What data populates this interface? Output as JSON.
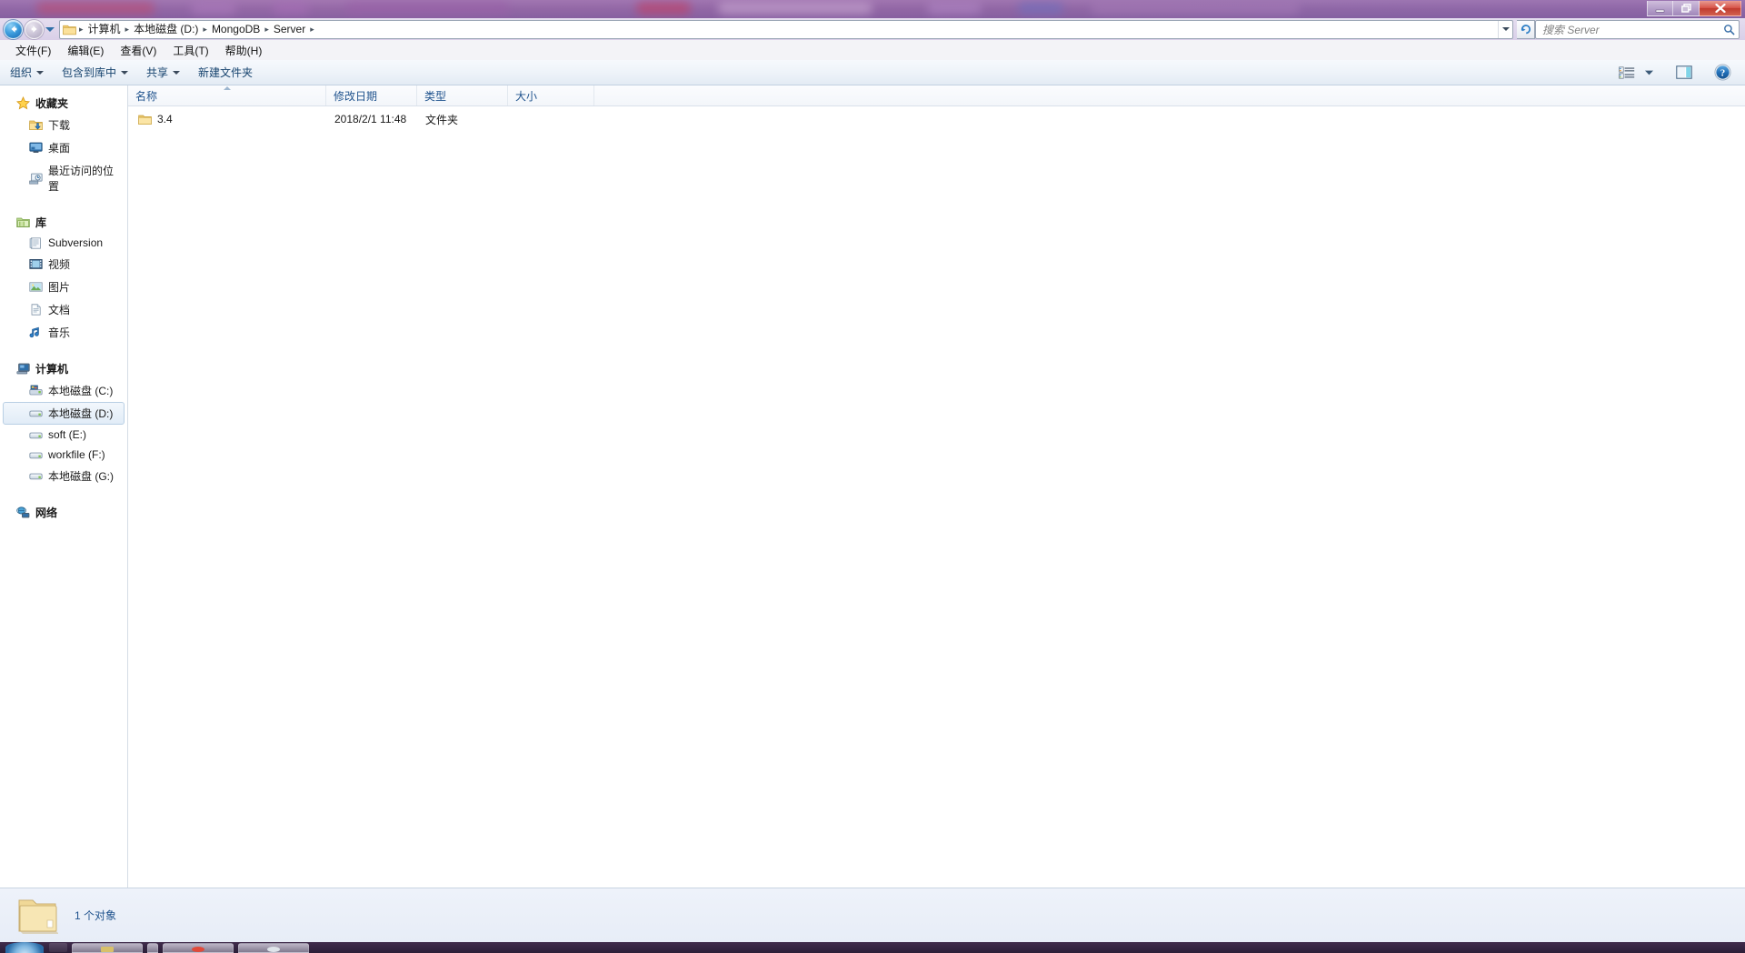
{
  "window": {
    "controls": [
      {
        "name": "minimize",
        "glyph": "minimize"
      },
      {
        "name": "restore",
        "glyph": "restore"
      },
      {
        "name": "close",
        "glyph": "close"
      }
    ]
  },
  "navbar": {
    "back_tooltip": "后退",
    "forward_tooltip": "前进",
    "recent_tooltip": "最近访问的位置",
    "breadcrumbs": [
      {
        "label": "计算机"
      },
      {
        "label": "本地磁盘 (D:)"
      },
      {
        "label": "MongoDB"
      },
      {
        "label": "Server"
      }
    ],
    "refresh_icon": "refresh-icon",
    "folder_icon": "folder-icon"
  },
  "search": {
    "placeholder": "搜索 Server",
    "value": "",
    "icon": "search-icon"
  },
  "menubar": {
    "items": [
      {
        "label": "文件(F)"
      },
      {
        "label": "编辑(E)"
      },
      {
        "label": "查看(V)"
      },
      {
        "label": "工具(T)"
      },
      {
        "label": "帮助(H)"
      }
    ]
  },
  "toolbar": {
    "items": [
      {
        "label": "组织",
        "has_caret": true
      },
      {
        "label": "包含到库中",
        "has_caret": true
      },
      {
        "label": "共享",
        "has_caret": true
      },
      {
        "label": "新建文件夹",
        "has_caret": false
      }
    ],
    "right_icons": [
      {
        "name": "change-view-icon"
      },
      {
        "name": "view-caret-icon"
      },
      {
        "name": "preview-pane-icon"
      },
      {
        "name": "help-icon"
      }
    ]
  },
  "sidebar": {
    "groups": [
      {
        "head": {
          "label": "收藏夹",
          "icon": "star-icon"
        },
        "items": [
          {
            "label": "下载",
            "icon": "downloads-folder-icon"
          },
          {
            "label": "桌面",
            "icon": "desktop-icon"
          },
          {
            "label": "最近访问的位置",
            "icon": "recent-places-icon"
          }
        ]
      },
      {
        "head": {
          "label": "库",
          "icon": "libraries-icon"
        },
        "items": [
          {
            "label": "Subversion",
            "icon": "library-icon"
          },
          {
            "label": "视频",
            "icon": "videos-icon"
          },
          {
            "label": "图片",
            "icon": "pictures-icon"
          },
          {
            "label": "文档",
            "icon": "documents-icon"
          },
          {
            "label": "音乐",
            "icon": "music-icon"
          }
        ]
      },
      {
        "head": {
          "label": "计算机",
          "icon": "computer-icon"
        },
        "items": [
          {
            "label": "本地磁盘 (C:)",
            "icon": "system-drive-icon",
            "selected": false
          },
          {
            "label": "本地磁盘 (D:)",
            "icon": "drive-icon",
            "selected": true
          },
          {
            "label": "soft (E:)",
            "icon": "drive-icon",
            "selected": false
          },
          {
            "label": "workfile (F:)",
            "icon": "drive-icon",
            "selected": false
          },
          {
            "label": "本地磁盘 (G:)",
            "icon": "drive-icon",
            "selected": false
          }
        ]
      },
      {
        "head": {
          "label": "网络",
          "icon": "network-icon"
        },
        "items": []
      }
    ]
  },
  "filelist": {
    "columns": [
      {
        "label": "名称",
        "sorted": true
      },
      {
        "label": "修改日期",
        "sorted": false
      },
      {
        "label": "类型",
        "sorted": false
      },
      {
        "label": "大小",
        "sorted": false
      }
    ],
    "rows": [
      {
        "name": "3.4",
        "date": "2018/2/1 11:48",
        "type": "文件夹",
        "size": "",
        "icon": "folder-icon"
      }
    ]
  },
  "statusbar": {
    "count_text": "1 个对象",
    "icon": "large-folder-icon"
  },
  "colors": {
    "accent": "#21548e",
    "close_button": "#c03a2e",
    "selection": "#e1ecf7",
    "glass": "#8a6aa8"
  }
}
